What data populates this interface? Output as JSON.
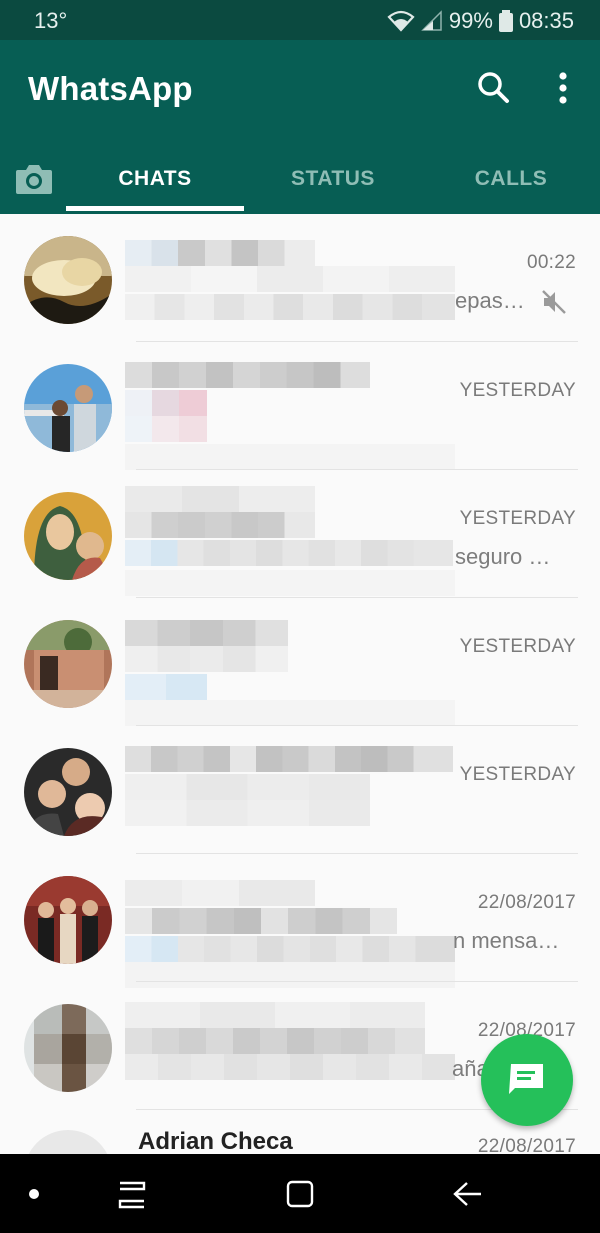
{
  "status_bar": {
    "left_text": "13°",
    "battery": "99%",
    "time": "08:35"
  },
  "app_bar": {
    "title": "WhatsApp",
    "search_icon": "search-icon",
    "more_icon": "more-vert-icon"
  },
  "tabs": [
    {
      "label": "CHATS",
      "selected": true
    },
    {
      "label": "STATUS",
      "selected": false
    },
    {
      "label": "CALLS",
      "selected": false
    }
  ],
  "chats": [
    {
      "time": "00:22",
      "preview_tail": "epas…",
      "muted": true
    },
    {
      "time": "YESTERDAY",
      "preview_tail": ""
    },
    {
      "time": "YESTERDAY",
      "preview_tail": "seguro …"
    },
    {
      "time": "YESTERDAY",
      "preview_tail": ""
    },
    {
      "time": "YESTERDAY",
      "preview_tail": ""
    },
    {
      "time": "22/08/2017",
      "preview_tail": "n mensa…"
    },
    {
      "time": "22/08/2017",
      "preview_tail": "aña"
    },
    {
      "name": "Adrian Checa",
      "time": "22/08/2017"
    }
  ],
  "colors": {
    "primary": "#075e54",
    "status_bar": "#0b4a40",
    "accent": "#25c05a"
  },
  "fab_icon": "new-chat-icon",
  "nav_icons": [
    "dot-icon",
    "recents-icon",
    "home-icon",
    "back-icon"
  ]
}
